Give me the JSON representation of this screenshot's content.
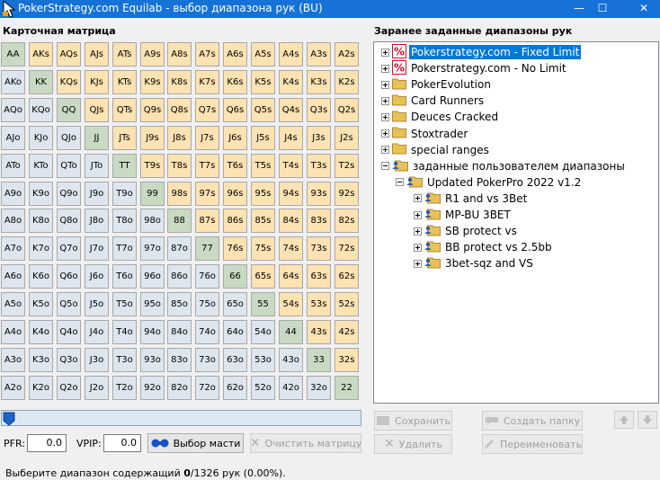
{
  "window": {
    "title": "PokerStrategy.com Equilab - выбор диапазона рук (BU)",
    "controls": {
      "minimize": "—",
      "maximize": "☐",
      "close": "✕"
    }
  },
  "matrix": {
    "label": "Карточная матрица",
    "rows": [
      [
        "AA",
        "AKs",
        "AQs",
        "AJs",
        "ATs",
        "A9s",
        "A8s",
        "A7s",
        "A6s",
        "A5s",
        "A4s",
        "A3s",
        "A2s"
      ],
      [
        "AKo",
        "KK",
        "KQs",
        "KJs",
        "KTs",
        "K9s",
        "K8s",
        "K7s",
        "K6s",
        "K5s",
        "K4s",
        "K3s",
        "K2s"
      ],
      [
        "AQo",
        "KQo",
        "QQ",
        "QJs",
        "QTs",
        "Q9s",
        "Q8s",
        "Q7s",
        "Q6s",
        "Q5s",
        "Q4s",
        "Q3s",
        "Q2s"
      ],
      [
        "AJo",
        "KJo",
        "QJo",
        "JJ",
        "JTs",
        "J9s",
        "J8s",
        "J7s",
        "J6s",
        "J5s",
        "J4s",
        "J3s",
        "J2s"
      ],
      [
        "ATo",
        "KTo",
        "QTo",
        "JTo",
        "TT",
        "T9s",
        "T8s",
        "T7s",
        "T6s",
        "T5s",
        "T4s",
        "T3s",
        "T2s"
      ],
      [
        "A9o",
        "K9o",
        "Q9o",
        "J9o",
        "T9o",
        "99",
        "98s",
        "97s",
        "96s",
        "95s",
        "94s",
        "93s",
        "92s"
      ],
      [
        "A8o",
        "K8o",
        "Q8o",
        "J8o",
        "T8o",
        "98o",
        "88",
        "87s",
        "86s",
        "85s",
        "84s",
        "83s",
        "82s"
      ],
      [
        "A7o",
        "K7o",
        "Q7o",
        "J7o",
        "T7o",
        "97o",
        "87o",
        "77",
        "76s",
        "75s",
        "74s",
        "73s",
        "72s"
      ],
      [
        "A6o",
        "K6o",
        "Q6o",
        "J6o",
        "T6o",
        "96o",
        "86o",
        "76o",
        "66",
        "65s",
        "64s",
        "63s",
        "62s"
      ],
      [
        "A5o",
        "K5o",
        "Q5o",
        "J5o",
        "T5o",
        "95o",
        "85o",
        "75o",
        "65o",
        "55",
        "54s",
        "53s",
        "52s"
      ],
      [
        "A4o",
        "K4o",
        "Q4o",
        "J4o",
        "T4o",
        "94o",
        "84o",
        "74o",
        "64o",
        "54o",
        "44",
        "43s",
        "42s"
      ],
      [
        "A3o",
        "K3o",
        "Q3o",
        "J3o",
        "T3o",
        "93o",
        "83o",
        "73o",
        "63o",
        "53o",
        "43o",
        "33",
        "32s"
      ],
      [
        "A2o",
        "K2o",
        "Q2o",
        "J2o",
        "T2o",
        "92o",
        "82o",
        "72o",
        "62o",
        "52o",
        "42o",
        "32o",
        "22"
      ]
    ],
    "colors": {
      "suited": "#fde2b2",
      "offsuit": "#dde6ee",
      "pair": "#c9dac3"
    }
  },
  "slider": {
    "value": 0
  },
  "controls": {
    "pfr_label": "PFR:",
    "pfr_value": "0.0",
    "vpip_label": "VPIP:",
    "vpip_value": "0.0",
    "suit_select_label": "Выбор масти",
    "clear_matrix_label": "Очистить матрицу"
  },
  "ranges": {
    "label": "Заранее заданные диапазоны рук",
    "tree": [
      {
        "label": "Pokerstrategy.com - Fixed Limit",
        "icon": "percent-icon",
        "selected": true
      },
      {
        "label": "Pokerstrategy.com - No Limit",
        "icon": "percent-icon"
      },
      {
        "label": "PokerEvolution",
        "icon": "folder-icon"
      },
      {
        "label": "Card Runners",
        "icon": "folder-icon"
      },
      {
        "label": "Deuces Cracked",
        "icon": "folder-icon"
      },
      {
        "label": "Stoxtrader",
        "icon": "folder-icon"
      },
      {
        "label": "special ranges",
        "icon": "folder-icon"
      },
      {
        "label": "заданные пользователем диапазоны",
        "icon": "user-folder-icon",
        "expanded": true
      },
      {
        "label": "Updated PokerPro 2022 v1.2",
        "icon": "user-folder-icon",
        "expanded": true
      },
      {
        "label": "R1 and vs 3Bet",
        "icon": "user-folder-icon"
      },
      {
        "label": "MP-BU 3BET",
        "icon": "user-folder-icon"
      },
      {
        "label": "SB protect vs",
        "icon": "user-folder-icon"
      },
      {
        "label": "BB protect vs 2.5bb",
        "icon": "user-folder-icon"
      },
      {
        "label": "3bet-sqz and VS",
        "icon": "user-folder-icon"
      }
    ]
  },
  "range_actions": {
    "save": "Сохранить",
    "create_folder": "Создать папку",
    "delete": "Удалить",
    "rename": "Переименовать"
  },
  "status": {
    "prefix": "Выберите диапазон содержащий ",
    "selected": "0",
    "suffix": "/1326 рук (0.00%)."
  }
}
